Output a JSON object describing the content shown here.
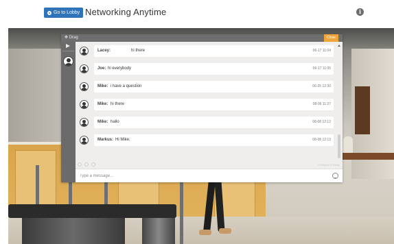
{
  "header": {
    "lobby_button_label": "Go to Lobby",
    "title": "Networking Anytime",
    "info_icon": "info-icon"
  },
  "chat": {
    "drag_label": "Drag",
    "close_label": "Close",
    "messages": [
      {
        "name": "Lacey:",
        "text": "hi there",
        "time": "06-17 11:04"
      },
      {
        "name": "Joe:",
        "text": "hi everybody",
        "time": "06-17 11:05"
      },
      {
        "name": "Mike:",
        "text": "i have a question",
        "time": "06-25 12:30"
      },
      {
        "name": "Mike:",
        "text": "hi there",
        "time": "08-06 11:27"
      },
      {
        "name": "Mike:",
        "text": "hallo",
        "time": "08-08 12:12"
      },
      {
        "name": "Markus:",
        "text": "Hi Mike,",
        "time": "08-08 12:13"
      }
    ],
    "footer_status": "0 Replies 0 Views",
    "input_placeholder": "Type a message..."
  },
  "colors": {
    "lobby_button": "#2f73b9",
    "close_button": "#f0a53a",
    "chat_header": "#6e6e6e"
  }
}
